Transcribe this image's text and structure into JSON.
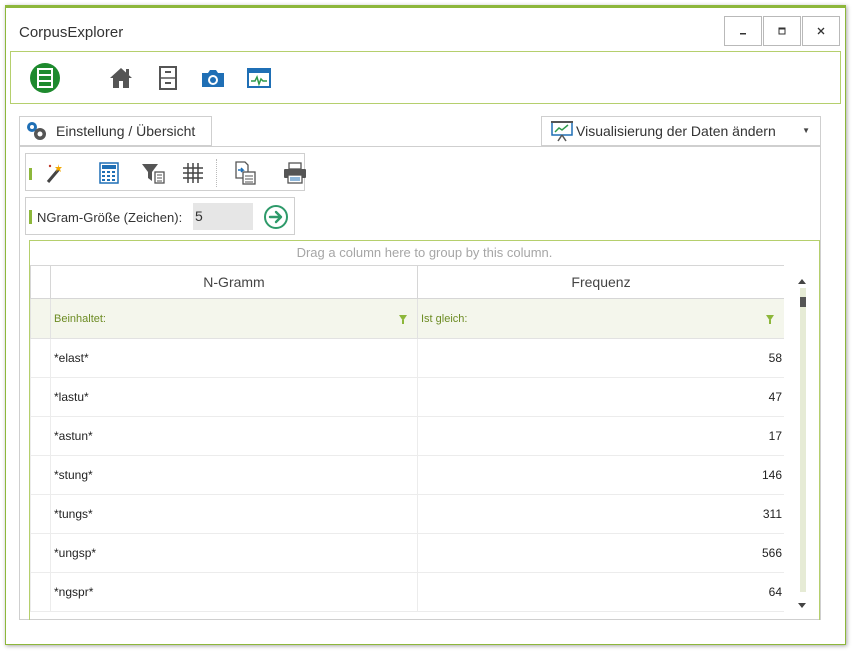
{
  "window": {
    "title": "CorpusExplorer",
    "controls": {
      "minimize": "▁",
      "maximize": "▫",
      "close": "✕"
    }
  },
  "ribbon": {
    "items": [
      "database-icon",
      "home-icon",
      "cabinet-icon",
      "camera-icon",
      "monitor-chart-icon"
    ]
  },
  "tabs": {
    "settings_label": "Einstellung / Übersicht",
    "visualize_label": "Visualisierung der Daten ändern"
  },
  "toolbar": {
    "tools": [
      "magic-wand-icon",
      "calculator-icon",
      "filter-icon",
      "grid-icon",
      "export-icon",
      "print-icon"
    ]
  },
  "ngram": {
    "label": "NGram-Größe (Zeichen):",
    "value": "5"
  },
  "grid": {
    "group_hint": "Drag a column here to group by this column.",
    "columns": [
      "N-Gramm",
      "Frequenz"
    ],
    "filters": [
      "Beinhaltet:",
      "Ist gleich:"
    ],
    "rows": [
      {
        "ngram": "*elast*",
        "freq": "58"
      },
      {
        "ngram": "*lastu*",
        "freq": "47"
      },
      {
        "ngram": "*astun*",
        "freq": "17"
      },
      {
        "ngram": "*stung*",
        "freq": "146"
      },
      {
        "ngram": "*tungs*",
        "freq": "311"
      },
      {
        "ngram": "*ungsp*",
        "freq": "566"
      },
      {
        "ngram": "*ngspr*",
        "freq": "64"
      }
    ]
  },
  "colors": {
    "accent": "#8db73b",
    "filter_text": "#6d8c24",
    "filter_bg": "#f4f6ec"
  }
}
